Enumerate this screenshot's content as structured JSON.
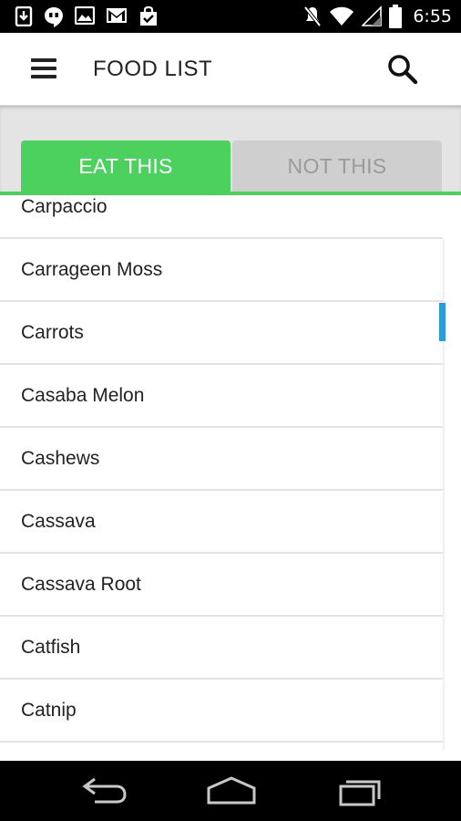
{
  "status_bar": {
    "time": "6:55",
    "left_icons": [
      "download-icon",
      "hangouts-icon",
      "image-icon",
      "gmail-icon",
      "shopping-bag-icon"
    ],
    "right_icons": [
      "mute-icon",
      "wifi-icon",
      "signal-icon",
      "battery-icon"
    ]
  },
  "app_bar": {
    "title": "FOOD LIST",
    "menu_icon": "hamburger-menu-icon",
    "search_icon": "search-icon"
  },
  "tabs": [
    {
      "label": "EAT THIS",
      "selected": true
    },
    {
      "label": "NOT THIS",
      "selected": false
    }
  ],
  "food_list": [
    "Carpaccio",
    "Carrageen Moss",
    "Carrots",
    "Casaba Melon",
    "Cashews",
    "Cassava",
    "Cassava Root",
    "Catfish",
    "Catnip"
  ],
  "nav_bar": {
    "buttons": [
      "back-icon",
      "home-icon",
      "recent-apps-icon"
    ]
  },
  "colors": {
    "accent_green": "#4cd15e",
    "scrollbar_blue": "#2a9dd6",
    "tab_inactive": "#cfcfcf"
  }
}
